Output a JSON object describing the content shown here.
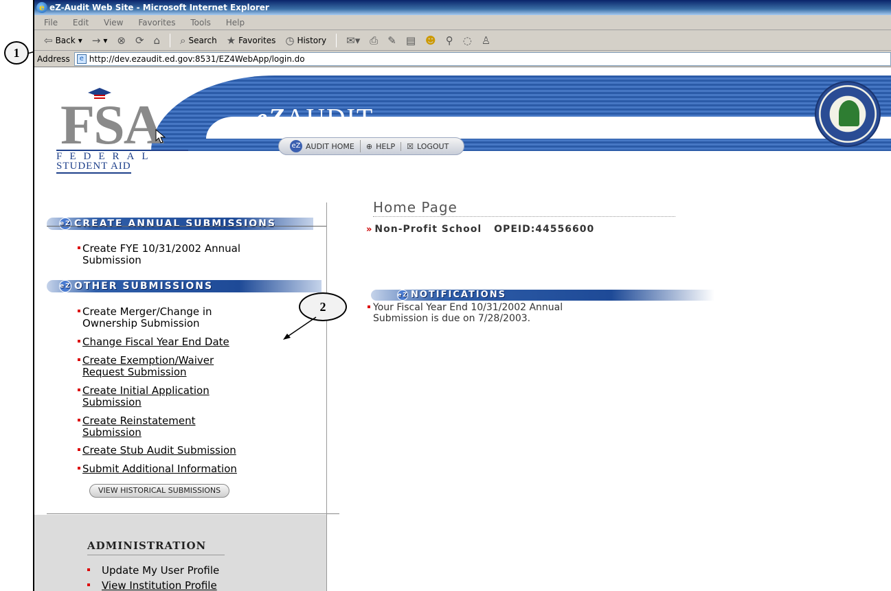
{
  "window": {
    "title": "eZ-Audit Web Site - Microsoft Internet Explorer"
  },
  "menubar": {
    "items": [
      "File",
      "Edit",
      "View",
      "Favorites",
      "Tools",
      "Help"
    ]
  },
  "toolbar": {
    "back": "Back",
    "search": "Search",
    "favorites": "Favorites",
    "history": "History"
  },
  "address": {
    "label": "Address",
    "url": "http://dev.ezaudit.ed.gov:8531/EZ4WebApp/login.do"
  },
  "header": {
    "logo_letters": "FSA",
    "logo_federal": "FEDERAL",
    "logo_student_aid": "STUDENT AID",
    "app_name_prefix": "eZ",
    "app_name_suffix": "AUDIT",
    "nav": [
      "AUDIT HOME",
      "HELP",
      "LOGOUT"
    ]
  },
  "left": {
    "annual_heading": "CREATE ANNUAL SUBMISSIONS",
    "annual_item_line1": "Create FYE 10/31/2002 Annual",
    "annual_item_line2": "Submission",
    "other_heading": "OTHER SUBMISSIONS",
    "other_items": [
      {
        "l1": "Create Merger/Change in",
        "l2": "Ownership Submission"
      },
      {
        "l1": "Change Fiscal Year End Date",
        "l2": ""
      },
      {
        "l1": "Create Exemption/Waiver",
        "l2": "Request Submission"
      },
      {
        "l1": "Create Initial Application",
        "l2": "Submission"
      },
      {
        "l1": "Create Reinstatement",
        "l2": "Submission"
      },
      {
        "l1": "Create Stub Audit Submission",
        "l2": ""
      },
      {
        "l1": "Submit Additional Information",
        "l2": ""
      }
    ],
    "view_historical": "VIEW HISTORICAL SUBMISSIONS",
    "admin_heading": "ADMINISTRATION",
    "admin_items": [
      "Update My User Profile",
      "View Institution Profile"
    ]
  },
  "main": {
    "page_title": "Home Page",
    "school_marker": "»",
    "school_name": "Non-Profit School",
    "opeid": "OPEID:44556600",
    "notifications_heading": "NOTIFICATIONS",
    "notification_line1": "Your Fiscal Year End 10/31/2002 Annual",
    "notification_line2": "Submission is due on 7/28/2003."
  },
  "callouts": {
    "one": "1",
    "two": "2"
  }
}
